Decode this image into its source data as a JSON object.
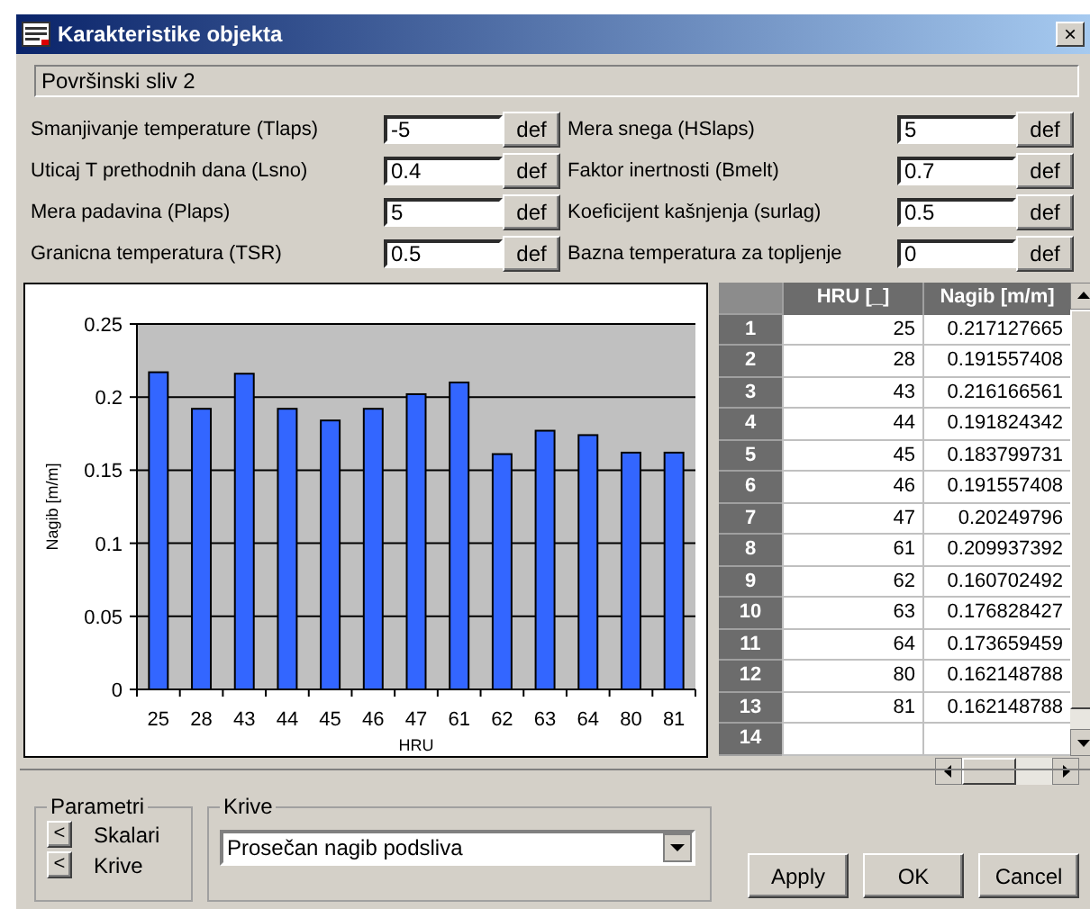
{
  "window": {
    "title": "Karakteristike objekta",
    "close": "×"
  },
  "object_name": "Površinski sliv  2",
  "params_left": [
    {
      "label": "Smanjivanje temperature (Tlaps)",
      "value": "-5",
      "button": "def"
    },
    {
      "label": "Uticaj T prethodnih dana (Lsno)",
      "value": "0.4",
      "button": "def"
    },
    {
      "label": "Mera padavina (Plaps)",
      "value": "5",
      "button": "def"
    },
    {
      "label": "Granicna temperatura (TSR)",
      "value": "0.5",
      "button": "def"
    }
  ],
  "params_right": [
    {
      "label": "Mera snega (HSlaps)",
      "value": "5",
      "button": "def"
    },
    {
      "label": "Faktor inertnosti (Bmelt)",
      "value": "0.7",
      "button": "def"
    },
    {
      "label": "Koeficijent kašnjenja (surlag)",
      "value": "0.5",
      "button": "def"
    },
    {
      "label": "Bazna temperatura za topljenje",
      "value": "0",
      "button": "def"
    }
  ],
  "chart_data": {
    "type": "bar",
    "xlabel": "HRU",
    "ylabel": "Nagib [m/m]",
    "categories": [
      "25",
      "28",
      "43",
      "44",
      "45",
      "46",
      "47",
      "61",
      "62",
      "63",
      "64",
      "80",
      "81"
    ],
    "series": [
      {
        "color": "#3366ff",
        "values": [
          0.217,
          0.192,
          0.216,
          0.192,
          0.184,
          0.192,
          0.202,
          0.21,
          0.161,
          0.177,
          0.174,
          0.162,
          0.162
        ]
      }
    ],
    "grid": true,
    "ylim": [
      0,
      0.25
    ],
    "yticks": [
      {
        "value": 0,
        "label": "0"
      },
      {
        "value": 0.05,
        "label": "0.05"
      },
      {
        "value": 0.1,
        "label": "0.1"
      },
      {
        "value": 0.15,
        "label": "0.15"
      },
      {
        "value": 0.2,
        "label": "0.2"
      },
      {
        "value": 0.25,
        "label": "0.25"
      }
    ]
  },
  "table": {
    "columns": [
      "HRU [_]",
      "Nagib [m/m]"
    ],
    "rows": [
      {
        "num": "1",
        "cells": [
          "25",
          "0.217127665"
        ]
      },
      {
        "num": "2",
        "cells": [
          "28",
          "0.191557408"
        ]
      },
      {
        "num": "3",
        "cells": [
          "43",
          "0.216166561"
        ]
      },
      {
        "num": "4",
        "cells": [
          "44",
          "0.191824342"
        ]
      },
      {
        "num": "5",
        "cells": [
          "45",
          "0.183799731"
        ]
      },
      {
        "num": "6",
        "cells": [
          "46",
          "0.191557408"
        ]
      },
      {
        "num": "7",
        "cells": [
          "47",
          "0.20249796"
        ]
      },
      {
        "num": "8",
        "cells": [
          "61",
          "0.209937392"
        ]
      },
      {
        "num": "9",
        "cells": [
          "62",
          "0.160702492"
        ]
      },
      {
        "num": "10",
        "cells": [
          "63",
          "0.176828427"
        ]
      },
      {
        "num": "11",
        "cells": [
          "64",
          "0.173659459"
        ]
      },
      {
        "num": "12",
        "cells": [
          "80",
          "0.162148788"
        ]
      },
      {
        "num": "13",
        "cells": [
          "81",
          "0.162148788"
        ]
      },
      {
        "num": "14",
        "cells": [
          "",
          ""
        ]
      }
    ]
  },
  "parametri": {
    "legend": "Parametri",
    "items": [
      {
        "button": "<",
        "label": "Skalari"
      },
      {
        "button": "<",
        "label": "Krive"
      }
    ]
  },
  "krive": {
    "legend": "Krive",
    "value": "Prosečan nagib podsliva"
  },
  "buttons": [
    "Apply",
    "OK",
    "Cancel"
  ]
}
